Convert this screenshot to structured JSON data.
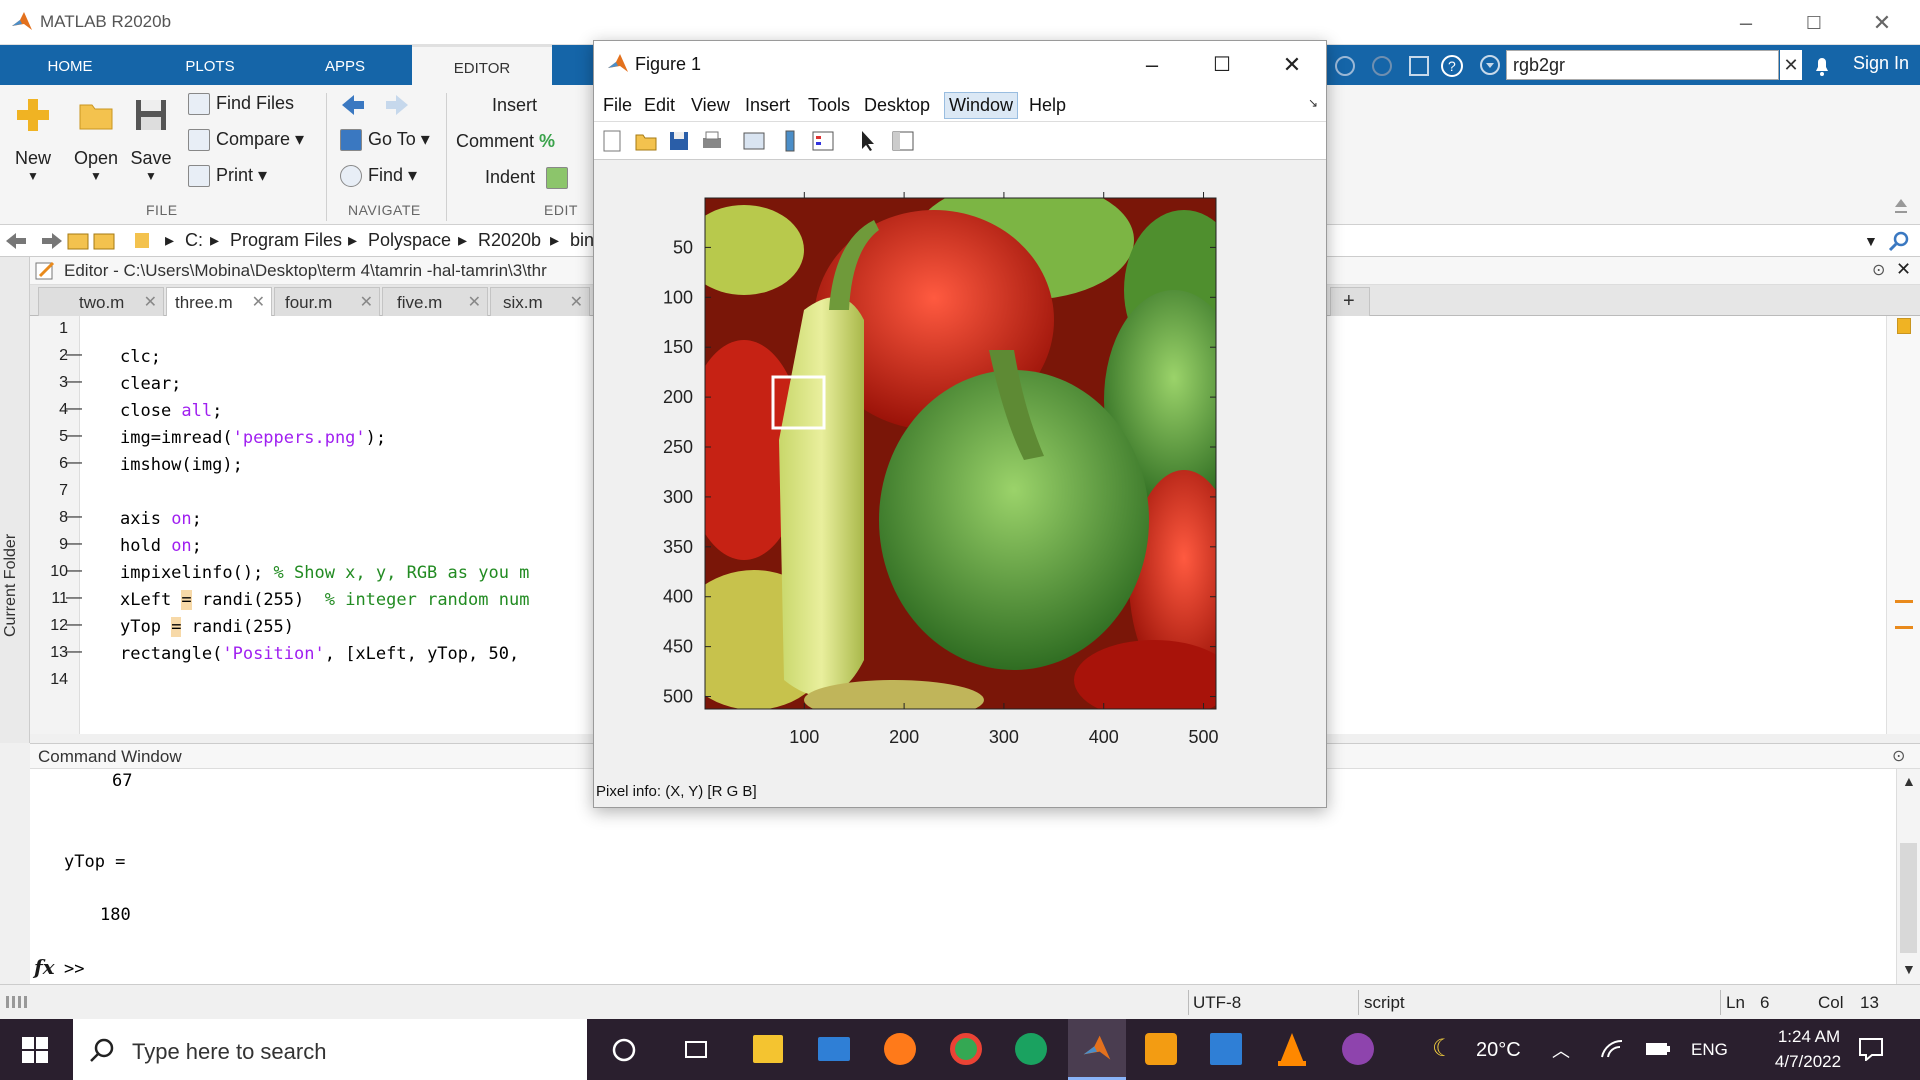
{
  "app": {
    "title": "MATLAB R2020b"
  },
  "ribbon": {
    "tabs": [
      "HOME",
      "PLOTS",
      "APPS",
      "EDITOR"
    ],
    "search_value": "rgb2gr",
    "sign_in": "Sign In"
  },
  "toolstrip": {
    "file": {
      "new": "New",
      "open": "Open",
      "save": "Save",
      "find_files": "Find Files",
      "compare": "Compare",
      "print": "Print",
      "label": "FILE"
    },
    "navigate": {
      "go_to": "Go To",
      "find": "Find",
      "label": "NAVIGATE"
    },
    "edit": {
      "insert": "Insert",
      "comment": "Comment",
      "indent": "Indent",
      "label": "EDIT",
      "percent": "%"
    }
  },
  "address": {
    "items": [
      "C:",
      "Program Files",
      "Polyspace",
      "R2020b",
      "bin"
    ]
  },
  "editor": {
    "path": "Editor - C:\\Users\\Mobina\\Desktop\\term 4\\tamrin -hal-tamrin\\3\\thr",
    "tabs": [
      "two.m",
      "three.m",
      "four.m",
      "five.m",
      "six.m"
    ],
    "active_tab": "three.m",
    "line_numbers": [
      "1",
      "2",
      "3",
      "4",
      "5",
      "6",
      "7",
      "8",
      "9",
      "10",
      "11",
      "12",
      "13",
      "14"
    ],
    "exec_marks": [
      "",
      "—",
      "—",
      "—",
      "—",
      "—",
      "",
      "—",
      "—",
      "—",
      "—",
      "—",
      "—",
      ""
    ]
  },
  "left_panel": {
    "label": "Current Folder"
  },
  "command_window": {
    "title": "Command Window",
    "lines": [
      "67",
      "",
      "",
      "yTop =",
      "",
      "180"
    ],
    "prompt": ">>",
    "fx": "fx"
  },
  "statusbar": {
    "encoding": "UTF-8",
    "type": "script",
    "ln_label": "Ln",
    "ln": "6",
    "col_label": "Col",
    "col": "13"
  },
  "figure": {
    "title": "Figure 1",
    "menus": [
      "File",
      "Edit",
      "View",
      "Insert",
      "Tools",
      "Desktop",
      "Window",
      "Help"
    ],
    "active_menu": "Window",
    "pixel_info": "Pixel info: (X, Y)  [R G B]",
    "x_ticks": [
      "100",
      "200",
      "300",
      "400",
      "500"
    ],
    "y_ticks": [
      "50",
      "100",
      "150",
      "200",
      "250",
      "300",
      "350",
      "400",
      "450",
      "500"
    ]
  },
  "taskbar": {
    "search_placeholder": "Type here to search",
    "weather": "20°C",
    "lang": "ENG",
    "time": "1:24 AM",
    "date": "4/7/2022"
  },
  "colors": {
    "ribbon_blue": "#1565a8",
    "taskbar": "#2a1f2e",
    "accent_orange": "#e98a1c"
  }
}
